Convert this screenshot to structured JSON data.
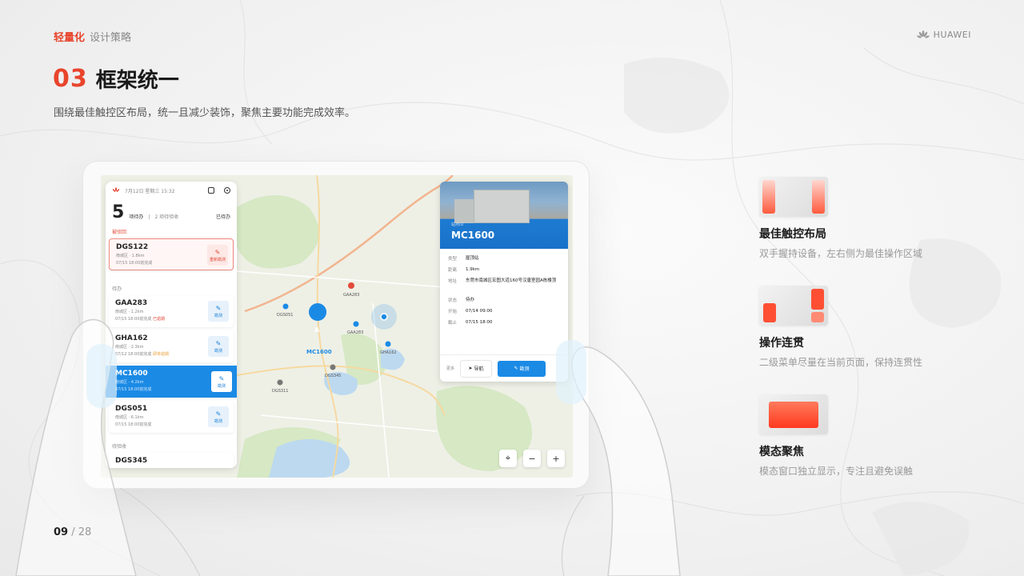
{
  "header": {
    "brand_accent": "轻量化",
    "brand_rest": "设计策略",
    "logo_text": "HUAWEI"
  },
  "title": {
    "number": "03",
    "text": "框架统一"
  },
  "subtitle": "围绕最佳触控区布局，统一且减少装饰，聚焦主要功能完成效率。",
  "pager": {
    "current": "09",
    "separator": "/",
    "total": "28"
  },
  "colors": {
    "accent": "#e8452c",
    "primary_blue": "#1b8ae5",
    "alert_red": "#e24b3b"
  },
  "tablet": {
    "status": "7月12日 星期三 15:32",
    "summary": {
      "count": "5",
      "count_label": "项待办",
      "sep": "|",
      "secondary": "2 项待验收",
      "done": "已待办"
    },
    "sections": {
      "warning": "被驳回",
      "todo": "待办",
      "accept": "待验收"
    },
    "cards": [
      {
        "name": "DGS122",
        "line1": "南城区 · 1.8km",
        "line2": "07/15 18:00前完成",
        "btn": "重新勘测"
      },
      {
        "name": "GAA283",
        "line1": "南城区 · 1.2km",
        "line2": "07/15 18:00前完成",
        "tag": "已逾期",
        "btn": "勘测"
      },
      {
        "name": "GHA162",
        "line1": "南城区 · 2.3km",
        "line2": "07/12 18:00前完成",
        "tag": "即将逾期",
        "btn": "勘测"
      },
      {
        "name": "MC1600",
        "line1": "南城区 · 4.2km",
        "line2": "07/15 18:00前完成",
        "btn": "勘测"
      },
      {
        "name": "DGS051",
        "line1": "南城区 · 6.1km",
        "line2": "07/15 18:00前完成",
        "btn": "勘测"
      },
      {
        "name": "DGS345"
      }
    ],
    "map_labels": {
      "gaa283_red": "GAA283",
      "dgs051": "DGS051",
      "gaa283": "GAA283",
      "mc1600": "MC1600",
      "gha162": "GHA162",
      "dgs345": "DGS345",
      "dgs311": "DGS311"
    },
    "detail": {
      "kind": "站点ID",
      "code": "MC1600",
      "rows": [
        {
          "k": "类型",
          "v": "屋顶站"
        },
        {
          "k": "距离",
          "v": "1.9km"
        },
        {
          "k": "地址",
          "v": "东莞市南城区宏图大道160号汉唐室园A栋楼顶"
        },
        {
          "k": "状态",
          "v": "待办"
        },
        {
          "k": "开始",
          "v": "07/14 09:00"
        },
        {
          "k": "截止",
          "v": "07/15 18:00"
        }
      ],
      "more": "更多",
      "nav": "导航",
      "inspect": "勘测"
    },
    "zoom": {
      "locate": "⌖",
      "minus": "−",
      "plus": "+"
    }
  },
  "features": [
    {
      "title": "最佳触控布局",
      "desc": "双手握持设备，左右侧为最佳操作区域",
      "icon": "two-side-touch-zones-icon"
    },
    {
      "title": "操作连贯",
      "desc": "二级菜单尽量在当前页面，保持连贯性",
      "icon": "secondary-menu-continuity-icon"
    },
    {
      "title": "模态聚焦",
      "desc": "模态窗口独立显示，专注且避免误触",
      "icon": "modal-focus-icon"
    }
  ]
}
